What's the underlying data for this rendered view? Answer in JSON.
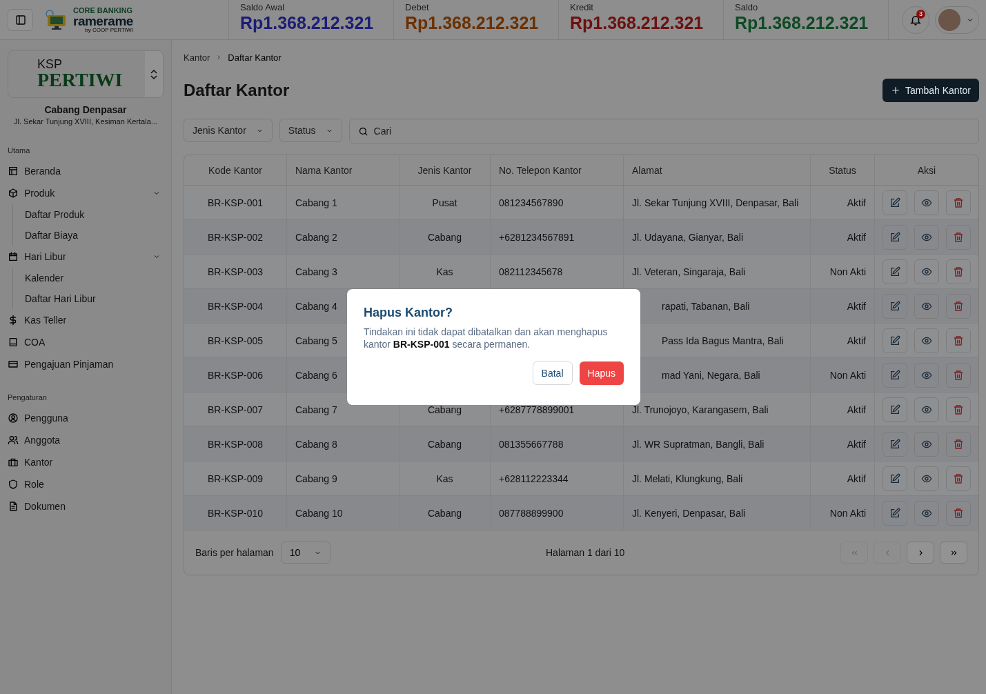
{
  "header": {
    "logo": {
      "title": "CORE BANKING",
      "name": "ramerame",
      "byline": "by COOP PERTIWI"
    },
    "stats": [
      {
        "label": "Saldo Awal",
        "value": "Rp1.368.212.321",
        "color": "#1c1c78"
      },
      {
        "label": "Debet",
        "value": "Rp1.368.212.321",
        "color": "#6b3000"
      },
      {
        "label": "Kredit",
        "value": "Rp1.368.212.321",
        "color": "#6e0f0f"
      },
      {
        "label": "Saldo",
        "value": "Rp1.368.212.321",
        "color": "#0e4a24"
      }
    ],
    "notifications": {
      "count": "3"
    }
  },
  "organization": {
    "logo_top": "KSP",
    "logo_name": "PERTIWI",
    "name": "Cabang Denpasar",
    "address": "Jl. Sekar Tunjung XVIII, Kesiman Kertala..."
  },
  "sidebar": {
    "sections": [
      {
        "title": "Utama",
        "items": [
          {
            "label": "Beranda",
            "kind": "layout"
          },
          {
            "label": "Produk",
            "kind": "box",
            "expanded": true,
            "children": [
              {
                "label": "Daftar Produk"
              },
              {
                "label": "Daftar Biaya"
              }
            ]
          },
          {
            "label": "Hari Libur",
            "kind": "calendar",
            "expanded": true,
            "children": [
              {
                "label": "Kalender"
              },
              {
                "label": "Daftar Hari Libur"
              }
            ]
          },
          {
            "label": "Kas Teller",
            "kind": "dollar"
          },
          {
            "label": "COA",
            "kind": "book"
          },
          {
            "label": "Pengajuan Pinjaman",
            "kind": "card"
          }
        ]
      },
      {
        "title": "Pengaturan",
        "items": [
          {
            "label": "Pengguna",
            "kind": "user"
          },
          {
            "label": "Anggota",
            "kind": "users"
          },
          {
            "label": "Kantor",
            "kind": "briefcase"
          },
          {
            "label": "Role",
            "kind": "shield"
          },
          {
            "label": "Dokumen",
            "kind": "file"
          }
        ]
      }
    ]
  },
  "breadcrumb": [
    "Kantor",
    "Daftar Kantor"
  ],
  "title": "Daftar Kantor",
  "add_button": "Tambah Kantor",
  "filters": [
    {
      "label": "Jenis Kantor"
    },
    {
      "label": "Status"
    }
  ],
  "search": {
    "placeholder": "Cari"
  },
  "table": {
    "columns": [
      "Kode Kantor",
      "Nama Kantor",
      "Jenis Kantor",
      "No. Telepon Kantor",
      "Alamat",
      "Status",
      "Aksi"
    ],
    "rows": [
      {
        "code": "BR-KSP-001",
        "name": "Cabang 1",
        "type": "Pusat",
        "phone": "081234567890",
        "address": "Jl. Sekar Tunjung XVIII, Denpasar, Bali",
        "status": "Aktif"
      },
      {
        "code": "BR-KSP-002",
        "name": "Cabang 2",
        "type": "Cabang",
        "phone": "+6281234567891",
        "address": "Jl. Udayana, Gianyar, Bali",
        "status": "Aktif"
      },
      {
        "code": "BR-KSP-003",
        "name": "Cabang 3",
        "type": "Kas",
        "phone": "082112345678",
        "address": "Jl. Veteran, Singaraja, Bali",
        "status": "Non Akti"
      },
      {
        "code": "BR-KSP-004",
        "name": "Cabang 4",
        "address": "rapati, Tabanan, Bali",
        "status": "Aktif"
      },
      {
        "code": "BR-KSP-005",
        "name": "Cabang 5",
        "address": "Pass Ida Bagus Mantra, Bali",
        "status": "Aktif"
      },
      {
        "code": "BR-KSP-006",
        "name": "Cabang 6",
        "address": "mad Yani, Negara, Bali",
        "status": "Non Akti"
      },
      {
        "code": "BR-KSP-007",
        "name": "Cabang 7",
        "type": "Cabang",
        "phone": "+6287778899001",
        "address": "Jl. Trunojoyo, Karangasem, Bali",
        "status": "Aktif"
      },
      {
        "code": "BR-KSP-008",
        "name": "Cabang 8",
        "type": "Cabang",
        "phone": "081355667788",
        "address": "Jl. WR Supratman, Bangli, Bali",
        "status": "Aktif"
      },
      {
        "code": "BR-KSP-009",
        "name": "Cabang 9",
        "type": "Kas",
        "phone": "+628112223344",
        "address": "Jl. Melati, Klungkung, Bali",
        "status": "Aktif"
      },
      {
        "code": "BR-KSP-010",
        "name": "Cabang 10",
        "type": "Cabang",
        "phone": "087788899900",
        "address": "Jl. Kenyeri, Denpasar, Bali",
        "status": "Non Akti"
      }
    ]
  },
  "pagination": {
    "rows_label": "Baris per halaman",
    "rows_value": "10",
    "page_text": "Halaman 1 dari 10",
    "buttons": [
      {
        "kind": "first",
        "disabled": true
      },
      {
        "kind": "prev",
        "disabled": true
      },
      {
        "kind": "next",
        "disabled": false
      },
      {
        "kind": "last",
        "disabled": false
      }
    ]
  },
  "dialog": {
    "title": "Hapus Kantor?",
    "message": "Tindakan ini tidak dapat dibatalkan dan akan menghapus kantor **BR-KSP-001** secara permanen.",
    "buttons": [
      {
        "label": "Batal",
        "kind": "secondary"
      },
      {
        "label": "Hapus",
        "kind": "danger"
      }
    ]
  }
}
